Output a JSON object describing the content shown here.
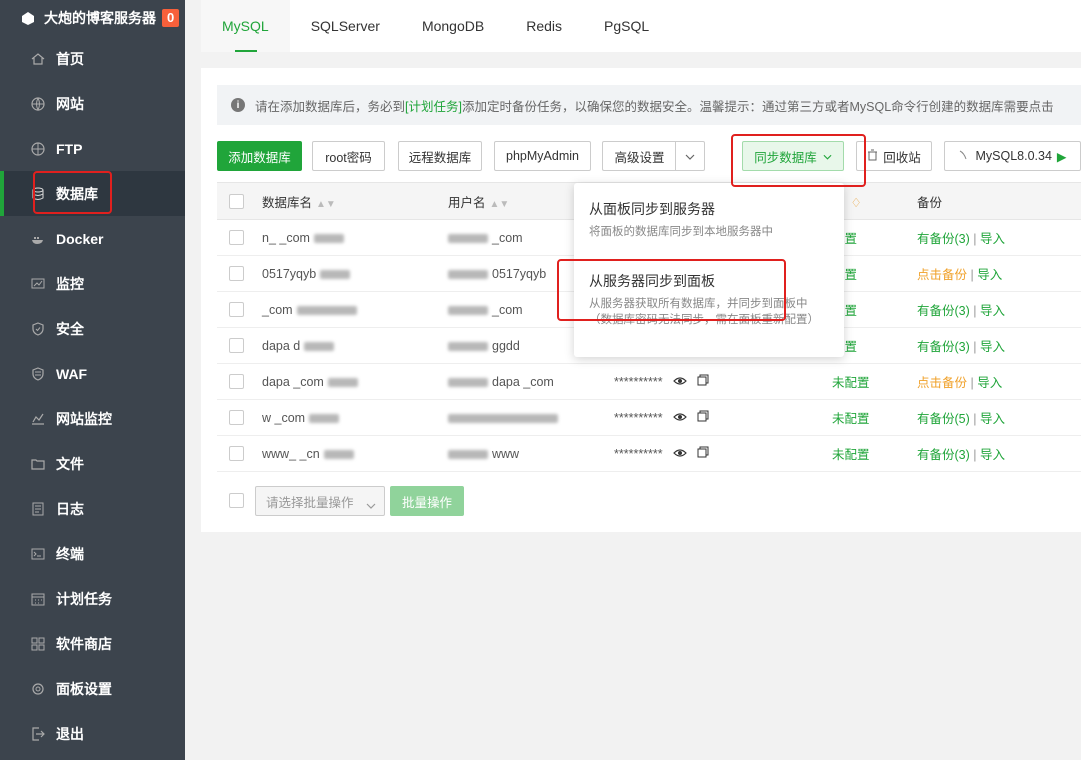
{
  "sidebar": {
    "title": "大炮的博客服务器",
    "badge": "0",
    "items": [
      {
        "label": "首页",
        "icon": "home-icon"
      },
      {
        "label": "网站",
        "icon": "globe-icon"
      },
      {
        "label": "FTP",
        "icon": "ftp-icon"
      },
      {
        "label": "数据库",
        "icon": "database-icon"
      },
      {
        "label": "Docker",
        "icon": "docker-icon"
      },
      {
        "label": "监控",
        "icon": "monitor-icon"
      },
      {
        "label": "安全",
        "icon": "shield-icon"
      },
      {
        "label": "WAF",
        "icon": "waf-icon"
      },
      {
        "label": "网站监控",
        "icon": "chart-icon"
      },
      {
        "label": "文件",
        "icon": "folder-icon"
      },
      {
        "label": "日志",
        "icon": "log-icon"
      },
      {
        "label": "终端",
        "icon": "terminal-icon"
      },
      {
        "label": "计划任务",
        "icon": "calendar-icon"
      },
      {
        "label": "软件商店",
        "icon": "grid-icon"
      },
      {
        "label": "面板设置",
        "icon": "gear-icon"
      },
      {
        "label": "退出",
        "icon": "logout-icon"
      }
    ]
  },
  "tabs": [
    "MySQL",
    "SQLServer",
    "MongoDB",
    "Redis",
    "PgSQL"
  ],
  "tip": {
    "prefix": "请在添加数据库后，务必到",
    "link": "[计划任务]",
    "suffix": "添加定时备份任务，以确保您的数据安全。温馨提示：通过第三方或者MySQL命令行创建的数据库需要点击"
  },
  "toolbar": {
    "add": "添加数据库",
    "root": "root密码",
    "remote": "远程数据库",
    "phpmyadmin": "phpMyAdmin",
    "advanced": "高级设置",
    "sync": "同步数据库",
    "recycle": "回收站",
    "version": "MySQL8.0.34"
  },
  "table": {
    "headers": [
      "数据库名",
      "用户名",
      "量",
      "备份"
    ],
    "rows": [
      {
        "name": "n_ _com",
        "user": "_com",
        "pwd": "",
        "cfg": "配置",
        "backup": "有备份(3)",
        "backup_type": "green",
        "import": "导入"
      },
      {
        "name": "0517yqyb",
        "user": "0517yqyb",
        "pwd": "",
        "cfg": "配置",
        "backup": "点击备份",
        "backup_type": "orange",
        "import": "导入"
      },
      {
        "name": "_com",
        "user": "_com",
        "pwd": "",
        "cfg": "配置",
        "backup": "有备份(3)",
        "backup_type": "green",
        "import": "导入"
      },
      {
        "name": "dapa d",
        "user": "ggdd",
        "pwd": "",
        "cfg": "配置",
        "backup": "有备份(3)",
        "backup_type": "green",
        "import": "导入"
      },
      {
        "name": "dapa _com",
        "user": "dapa _com",
        "pwd": "**********",
        "cfg": "未配置",
        "backup": "点击备份",
        "backup_type": "orange",
        "import": "导入"
      },
      {
        "name": "w _com",
        "user": "",
        "pwd": "**********",
        "cfg": "未配置",
        "backup": "有备份(5)",
        "backup_type": "green",
        "import": "导入"
      },
      {
        "name": "www_ _cn",
        "user": "www",
        "pwd": "**********",
        "cfg": "未配置",
        "backup": "有备份(3)",
        "backup_type": "green",
        "import": "导入"
      }
    ]
  },
  "dropdown": {
    "item1_title": "从面板同步到服务器",
    "item1_desc": "将面板的数据库同步到本地服务器中",
    "item2_title": "从服务器同步到面板",
    "item2_desc1": "从服务器获取所有数据库，并同步到面板中",
    "item2_desc2": "（数据库密码无法同步，需在面板重新配置）"
  },
  "bulk": {
    "placeholder": "请选择批量操作",
    "button": "批量操作"
  },
  "colors": {
    "accent": "#20a53a",
    "highlight": "#e0201e",
    "sidebar": "#3c444d"
  }
}
